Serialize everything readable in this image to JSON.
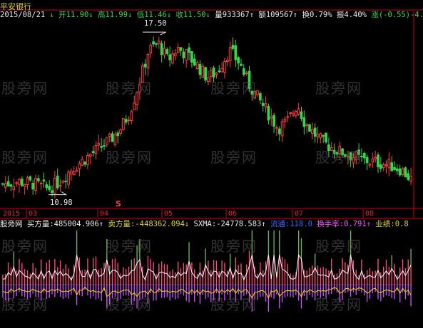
{
  "header": {
    "stock_name": "平安银行",
    "date": "2015/08/21",
    "open": "开11.90",
    "high": "高11.99",
    "low": "低11.46",
    "close": "收11.50",
    "volume": "量933367",
    "amount": "额109567",
    "turnover": "换0.79%",
    "amplitude": "振4.40%",
    "change": "涨(-0.55)-4.56%"
  },
  "indicator": {
    "name": "股旁网",
    "buy_label": "买方量:485004.906",
    "sell_label": "卖方量:-448362.094",
    "sxma_label": "SXMA:-24778.583",
    "liutong_label": "流通:118.0",
    "turnover_rate_label": "换手率:0.791",
    "performance_label": "业绩:0.8"
  },
  "watermark": "股旁网",
  "annotations": {
    "high_marker": "17.50",
    "low_marker": "10.98",
    "signal_marker": "S"
  },
  "time_axis": [
    "2015",
    "03",
    "04",
    "05",
    "06",
    "07",
    "08"
  ],
  "colors": {
    "up": "#ff3b3b",
    "down": "#34d64a",
    "header_text": "#e8e8e8",
    "date_text": "#e0d030",
    "axis_red": "#c8001a",
    "positive_bar": "#ff4d7a",
    "negative_bar": "#c850ff",
    "line_white": "#ffffff",
    "line_yellow": "#ffd700",
    "blue_text": "#4060ff",
    "pink_text": "#ff50ff"
  },
  "chart_data": {
    "type": "candlestick",
    "title": "平安银行",
    "ylim": [
      10.5,
      18.0
    ],
    "x_axis_labels": [
      "2015",
      "03",
      "04",
      "05",
      "06",
      "07",
      "08"
    ],
    "series_description": "daily candles from 2015/01 to 2015/08/21; rise from ~11 to peak 17.50 in April, then decline to ~11.5",
    "price_path": [
      [
        0,
        11.3
      ],
      [
        10,
        11.4
      ],
      [
        20,
        11.3
      ],
      [
        28,
        11.1
      ],
      [
        35,
        11.4
      ],
      [
        42,
        11.9
      ],
      [
        50,
        12.3
      ],
      [
        58,
        12.7
      ],
      [
        66,
        13.1
      ],
      [
        72,
        13.5
      ],
      [
        78,
        14.2
      ],
      [
        84,
        15.4
      ],
      [
        90,
        16.8
      ],
      [
        96,
        17.1
      ],
      [
        102,
        16.4
      ],
      [
        108,
        16.9
      ],
      [
        114,
        16.6
      ],
      [
        120,
        16.2
      ],
      [
        126,
        15.7
      ],
      [
        132,
        15.9
      ],
      [
        140,
        16.8
      ],
      [
        146,
        16.3
      ],
      [
        152,
        15.4
      ],
      [
        158,
        14.8
      ],
      [
        164,
        14.2
      ],
      [
        170,
        13.6
      ],
      [
        176,
        13.9
      ],
      [
        182,
        14.6
      ],
      [
        186,
        13.9
      ],
      [
        192,
        13.4
      ],
      [
        198,
        13.0
      ],
      [
        206,
        12.7
      ],
      [
        214,
        12.5
      ],
      [
        222,
        12.3
      ],
      [
        230,
        12.2
      ],
      [
        238,
        12.1
      ],
      [
        246,
        11.9
      ],
      [
        252,
        11.5
      ]
    ],
    "high_label": {
      "value": 17.5
    },
    "low_label": {
      "value": 10.98
    },
    "indicator_series": {
      "buy_volume": 485004.906,
      "sell_volume": -448362.094,
      "sxma": -24778.583,
      "liutong": 118.0,
      "turnover_rate": 0.791
    }
  }
}
